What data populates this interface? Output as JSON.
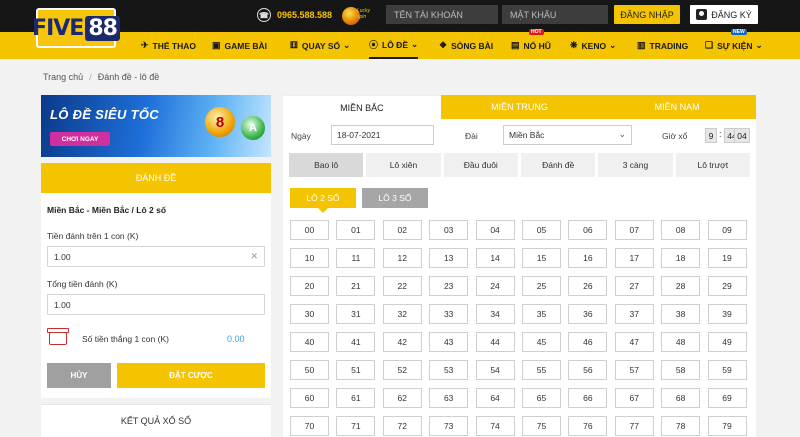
{
  "brand": {
    "logo_text_a": "FIVE",
    "logo_text_b": "88"
  },
  "header": {
    "hotline": "0965.588.588",
    "lucky_text": "Lucky spin",
    "username_placeholder": "TÊN TÀI KHOẢN",
    "password_placeholder": "MẬT KHẨU",
    "login_label": "ĐĂNG NHẬP",
    "register_label": "ĐĂNG KÝ"
  },
  "nav": {
    "items": [
      {
        "label": "THỂ THAO",
        "icon": "whistle-icon"
      },
      {
        "label": "GAME BÀI",
        "icon": "cards-icon"
      },
      {
        "label": "QUAY SỐ",
        "icon": "dice-icon",
        "dropdown": true
      },
      {
        "label": "LÔ ĐỀ",
        "icon": "lottery-icon",
        "dropdown": true,
        "active": true
      },
      {
        "label": "SÒNG BÀI",
        "icon": "casino-icon"
      },
      {
        "label": "NỔ HŨ",
        "icon": "jackpot-icon",
        "badge": "HOT"
      },
      {
        "label": "KENO",
        "icon": "keno-icon",
        "dropdown": true
      },
      {
        "label": "TRADING",
        "icon": "trading-icon"
      },
      {
        "label": "SỰ KIỆN",
        "icon": "gift-icon",
        "dropdown": true,
        "badge": "NEW"
      }
    ]
  },
  "breadcrumb": {
    "home": "Trang chủ",
    "current": "Đánh đề - lô đề"
  },
  "banner": {
    "title": "LÔ ĐỀ SIÊU TỐC",
    "cta": "CHƠI NGAY",
    "ball1": "8",
    "ball2": "A"
  },
  "bet_panel": {
    "header": "ĐÁNH ĐỀ",
    "selection": "Miền Bắc - Miền Bắc / Lô 2 số",
    "stake_label": "Tiền đánh trên 1 con (K)",
    "stake_value": "1.00",
    "total_label": "Tổng tiền đánh (K)",
    "total_value": "1.00",
    "win_label": "Số tiền thắng 1 con (K)",
    "win_value": "0.00",
    "cancel_label": "HỦY",
    "bet_label": "ĐẶT CƯỢC",
    "results_label": "KẾT QUẢ XỔ SỐ"
  },
  "regions": [
    "MIỀN BẮC",
    "MIỀN TRUNG",
    "MIỀN NAM"
  ],
  "filters": {
    "date_label": "Ngày",
    "date_value": "18-07-2021",
    "station_label": "Đài",
    "station_value": "Miền Bắc",
    "time_label": "Giờ xổ",
    "time_h": "9",
    "time_m": "44",
    "time_s": "04"
  },
  "bet_types": [
    "Bao lô",
    "Lô xiên",
    "Đầu đuôi",
    "Đánh đề",
    "3 càng",
    "Lô trượt"
  ],
  "sub_tabs": [
    "LÔ 2 SỐ",
    "LÔ 3 SỐ"
  ],
  "numbers": [
    "00",
    "01",
    "02",
    "03",
    "04",
    "05",
    "06",
    "07",
    "08",
    "09",
    "10",
    "11",
    "12",
    "13",
    "14",
    "15",
    "16",
    "17",
    "18",
    "19",
    "20",
    "21",
    "22",
    "23",
    "24",
    "25",
    "26",
    "27",
    "28",
    "29",
    "30",
    "31",
    "32",
    "33",
    "34",
    "35",
    "36",
    "37",
    "38",
    "39",
    "40",
    "41",
    "42",
    "43",
    "44",
    "45",
    "46",
    "47",
    "48",
    "49",
    "50",
    "51",
    "52",
    "53",
    "54",
    "55",
    "56",
    "57",
    "58",
    "59",
    "60",
    "61",
    "62",
    "63",
    "64",
    "65",
    "66",
    "67",
    "68",
    "69",
    "70",
    "71",
    "72",
    "73",
    "74",
    "75",
    "76",
    "77",
    "78",
    "79"
  ],
  "colors": {
    "accent": "#f5c400",
    "topbar": "#161616",
    "win_value": "#3aa3e3"
  }
}
